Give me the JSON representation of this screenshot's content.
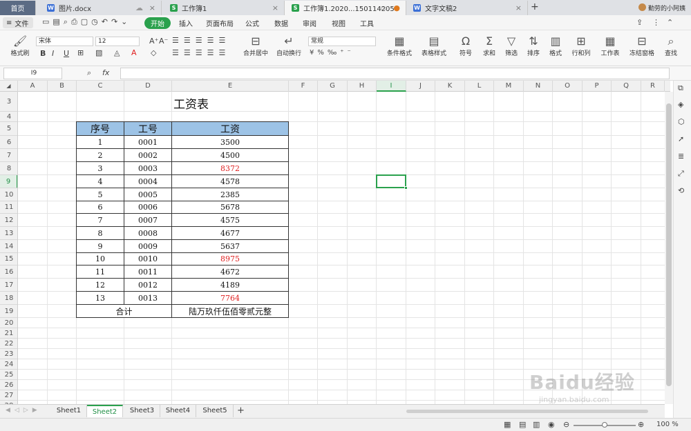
{
  "tabs": [
    {
      "label": "首页"
    },
    {
      "label": "图片.docx"
    },
    {
      "label": "工作簿1"
    },
    {
      "label": "工作簿1.2020...150114205"
    },
    {
      "label": "文字文稿2"
    }
  ],
  "user_name": "勤劳的小阿姨",
  "menu": {
    "file": "文件",
    "items": [
      "开始",
      "插入",
      "页面布局",
      "公式",
      "数据",
      "审阅",
      "视图",
      "工具"
    ]
  },
  "ribbon": {
    "format_painter": "格式刷",
    "font_name": "宋体",
    "font_size": "12",
    "merge_center": "合并居中",
    "wrap_text": "自动换行",
    "number_format": "常规",
    "cond_format": "条件格式",
    "table_style": "表格样式",
    "symbol": "符号",
    "sum": "求和",
    "filter": "筛选",
    "sort": "排序",
    "format": "格式",
    "row_col": "行和列",
    "worksheet": "工作表",
    "freeze": "冻结窗格",
    "find": "查找"
  },
  "formula_bar": {
    "cell_ref": "I9",
    "fx": "fx",
    "formula": ""
  },
  "columns": [
    "A",
    "B",
    "C",
    "D",
    "E",
    "F",
    "G",
    "H",
    "I",
    "J",
    "K",
    "L",
    "M",
    "N",
    "O",
    "P",
    "Q",
    "R"
  ],
  "rows": [
    "3",
    "4",
    "5",
    "6",
    "7",
    "8",
    "9",
    "10",
    "11",
    "12",
    "13",
    "14",
    "15",
    "16",
    "17",
    "18",
    "19",
    "20",
    "21",
    "22",
    "23",
    "24",
    "25",
    "26",
    "27",
    "28"
  ],
  "sheet": {
    "title": "工资表",
    "headers": [
      "序号",
      "工号",
      "工资"
    ],
    "data": [
      {
        "no": "1",
        "id": "0001",
        "salary": "3500",
        "red": false
      },
      {
        "no": "2",
        "id": "0002",
        "salary": "4500",
        "red": false
      },
      {
        "no": "3",
        "id": "0003",
        "salary": "8372",
        "red": true
      },
      {
        "no": "4",
        "id": "0004",
        "salary": "4578",
        "red": false
      },
      {
        "no": "5",
        "id": "0005",
        "salary": "2385",
        "red": false
      },
      {
        "no": "6",
        "id": "0006",
        "salary": "5678",
        "red": false
      },
      {
        "no": "7",
        "id": "0007",
        "salary": "4575",
        "red": false
      },
      {
        "no": "8",
        "id": "0008",
        "salary": "4677",
        "red": false
      },
      {
        "no": "9",
        "id": "0009",
        "salary": "5637",
        "red": false
      },
      {
        "no": "10",
        "id": "0010",
        "salary": "8975",
        "red": true
      },
      {
        "no": "11",
        "id": "0011",
        "salary": "4672",
        "red": false
      },
      {
        "no": "12",
        "id": "0012",
        "salary": "4189",
        "red": false
      },
      {
        "no": "13",
        "id": "0013",
        "salary": "7764",
        "red": true
      }
    ],
    "total_label": "合计",
    "total_value": "陆万玖仟伍佰零贰元整"
  },
  "sheet_tabs": [
    "Sheet1",
    "Sheet2",
    "Sheet3",
    "Sheet4",
    "Sheet5"
  ],
  "active_sheet": "Sheet2",
  "zoom": "100 %",
  "watermark": {
    "brand": "Baidu经验",
    "url": "jingyan.baidu.com"
  },
  "colors": {
    "accent": "#2aa14d",
    "header_fill": "#9dc3e6",
    "red_value": "#e02020"
  }
}
